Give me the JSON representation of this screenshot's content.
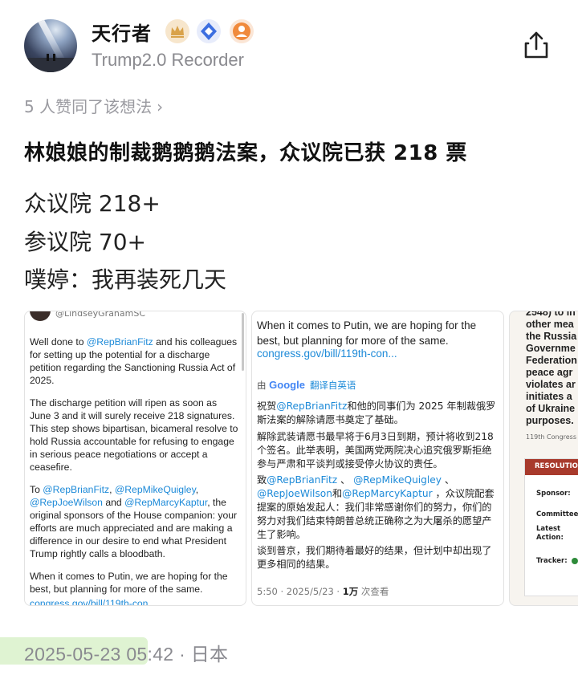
{
  "author": {
    "name": "天行者",
    "subtitle": "Trump2.0 Recorder",
    "badges": [
      "crown-badge-icon",
      "diamond-badge-icon",
      "person-badge-icon"
    ]
  },
  "likes_text": "5 人赞同了该想法",
  "post": {
    "title": "林娘娘的制裁鹅鹅鹅法案，众议院已获 218 票",
    "lines": [
      "众议院 218+",
      "参议院 70+",
      "噗婷：我再装死几天"
    ]
  },
  "card1": {
    "handle": "@LindseyGrahamSC",
    "p1a": "Well done to ",
    "p1m": "@RepBrianFitz",
    "p1b": " and his colleagues for setting up the potential for a discharge petition regarding the Sanctioning Russia Act of 2025.",
    "p2": "The discharge petition will ripen as soon as June 3 and it will surely receive 218 signatures. This step shows bipartisan, bicameral resolve to hold Russia accountable for refusing to engage in serious peace negotiations or accept a ceasefire.",
    "p3a": "To ",
    "p3m1": "@RepBrianFitz",
    "p3s1": ", ",
    "p3m2": "@RepMikeQuigley",
    "p3s2": ", ",
    "p3m3": "@RepJoeWilson",
    "p3s3": " and ",
    "p3m4": "@RepMarcyKaptur",
    "p3b": ", the original sponsors of the House companion: your efforts are much appreciated and are making a difference in our desire to end what President Trump rightly calls a bloodbath.",
    "p4": "When it comes to Putin, we are hoping for the best, but planning for more of the same.",
    "p5": "congress.gov/bill/119th-con"
  },
  "card2": {
    "en": "When it comes to Putin, we are hoping for the best, but planning for more of the same.",
    "link": "congress.gov/bill/119th-con...",
    "google_prefix": "由",
    "google": "Google",
    "translate": "翻译自英语",
    "cn1a": "祝贺",
    "cn1m": "@RepBrianFitz",
    "cn1b": "和他的同事们为 2025 年制裁俄罗斯法案的解除请愿书奠定了基础。",
    "cn2": "解除武装请愿书最早将于6月3日到期，预计将收到218个签名。此举表明，美国两党两院决心追究俄罗斯拒绝参与严肃和平谈判或接受停火协议的责任。",
    "cn3a": "致",
    "cn3m1": "@RepBrianFitz",
    "cn3s1": " 、 ",
    "cn3m2": "@RepMikeQuigley",
    "cn3s2": " 、",
    "cn3m3": "@RepJoeWilson",
    "cn3s3": "和",
    "cn3m4": "@RepMarcyKaptur",
    "cn3b": " ，众议院配套提案的原始发起人：我们非常感谢你们的努力，你们的努力对我们结束特朗普总统正确称之为大屠杀的愿望产生了影响。",
    "cn4": "谈到普京，我们期待着最好的结果，但计划中却出现了更多相同的结果。",
    "meta_time": "5:50 · 2025/5/23 · ",
    "meta_views": "1万",
    "meta_suffix": " 次查看"
  },
  "card3": {
    "lines": [
      "2548) to in",
      "other mea",
      "the Russia",
      "Governme",
      "Federation",
      "peace agr",
      "violates ar",
      "initiates a",
      "of Ukraine",
      "purposes."
    ],
    "congress": "119th Congress (2",
    "resolution": "RESOLUTION",
    "sponsor": "Sponsor:",
    "committees": "Committees:",
    "latest_action": "Latest Action:",
    "tracker": "Tracker:"
  },
  "timestamp": "2025-05-23 05:42 · 日本"
}
